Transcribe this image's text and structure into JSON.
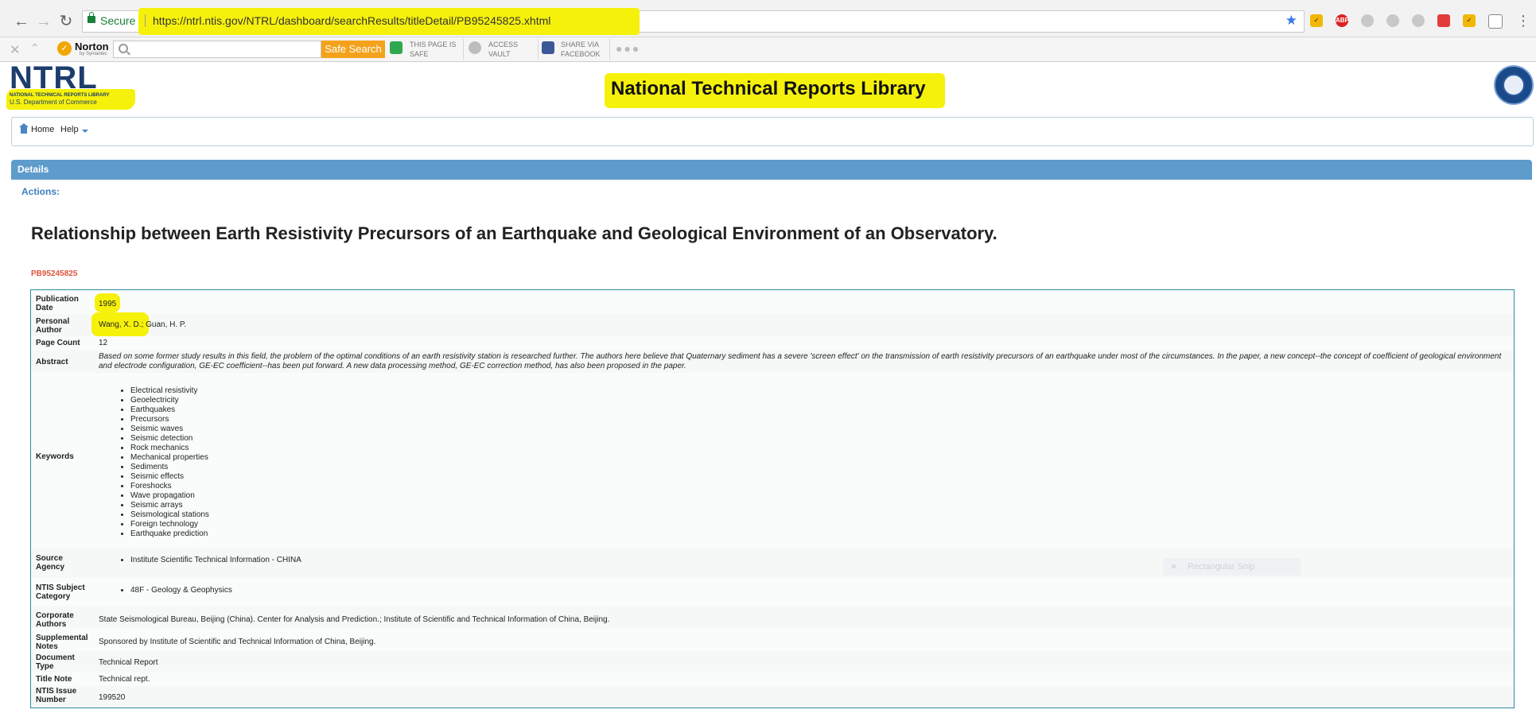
{
  "browser": {
    "secure_label": "Secure",
    "url": "https://ntrl.ntis.gov/NTRL/dashboard/searchResults/titleDetail/PB95245825.xhtml",
    "extension_icons": [
      "norton-safeweb-icon",
      "adblock-icon",
      "search-extension-icon",
      "privacy-icon",
      "search-extension-icon-2",
      "lastpass-icon",
      "norton-icon",
      "cast-icon"
    ]
  },
  "norton_toolbar": {
    "brand": "Norton",
    "brand_sub": "by Symantec",
    "search_placeholder": "",
    "safe_search_label": "Safe Search",
    "page_safe_line1": "THIS PAGE IS",
    "page_safe_line2": "SAFE",
    "vault_line1": "ACCESS",
    "vault_line2": "VAULT",
    "facebook_line1": "SHARE VIA",
    "facebook_line2": "FACEBOOK"
  },
  "header": {
    "logo_text": "NTRL",
    "logo_line1": "NATIONAL TECHNICAL REPORTS LIBRARY",
    "logo_line2": "U.S. Department of Commerce",
    "site_title": "National Technical Reports Library"
  },
  "nav": {
    "home_label": "Home",
    "help_label": "Help"
  },
  "details": {
    "section_title": "Details",
    "actions_label": "Actions:",
    "title": "Relationship between Earth Resistivity Precursors of an Earthquake and Geological Environment of an Observatory.",
    "report_id": "PB95245825",
    "fields": {
      "publication_date": {
        "label_1": "Publication",
        "label_2": "Date",
        "value": "1995"
      },
      "personal_author": {
        "label_1": "Personal",
        "label_2": "Author",
        "value_1": "Wang, X. D.;",
        "value_2": " Guan, H. P."
      },
      "page_count": {
        "label": "Page Count",
        "value": "12"
      },
      "abstract": {
        "label": "Abstract",
        "value": "Based on some former study results in this field, the problem of the optimal conditions of an earth resistivity station is researched further. The authors here believe that Quaternary sediment has a severe 'screen effect' on the transmission of earth resistivity precursors of an earthquake under most of the circumstances. In the paper, a new concept--the concept of coefficient of geological environment and electrode configuration, GE-EC coefficient--has been put forward. A new data processing method, GE-EC correction method, has also been proposed in the paper."
      },
      "keywords": {
        "label": "Keywords",
        "items": [
          "Electrical resistivity",
          "Geoelectricity",
          "Earthquakes",
          "Precursors",
          "Seismic waves",
          "Seismic detection",
          "Rock mechanics",
          "Mechanical properties",
          "Sediments",
          "Seismic effects",
          "Foreshocks",
          "Wave propagation",
          "Seismic arrays",
          "Seismological stations",
          "Foreign technology",
          "Earthquake prediction"
        ]
      },
      "source_agency": {
        "label_1": "Source",
        "label_2": "Agency",
        "value": "Institute Scientific Technical Information - CHINA"
      },
      "subject_category": {
        "label_1": "NTIS Subject",
        "label_2": "Category",
        "value": "48F - Geology & Geophysics"
      },
      "corporate_authors": {
        "label_1": "Corporate",
        "label_2": "Authors",
        "value": "State Seismological Bureau, Beijing (China). Center for Analysis and Prediction.; Institute of Scientific and Technical Information of China, Beijing."
      },
      "supplemental_notes": {
        "label_1": "Supplemental",
        "label_2": "Notes",
        "value": "Sponsored by Institute of Scientific and Technical Information of China, Beijing."
      },
      "document_type": {
        "label_1": "Document",
        "label_2": "Type",
        "value": "Technical Report"
      },
      "title_note": {
        "label": "Title Note",
        "value": "Technical rept."
      },
      "issue_number": {
        "label_1": "NTIS Issue",
        "label_2": "Number",
        "value": "199520"
      }
    }
  },
  "overlay": {
    "snip_label": "Rectangular Snip"
  },
  "colors": {
    "highlight": "#f6f10a",
    "details_bar": "#5d9ccb",
    "report_id": "#e0523c",
    "safe_search": "#f4a21c"
  }
}
